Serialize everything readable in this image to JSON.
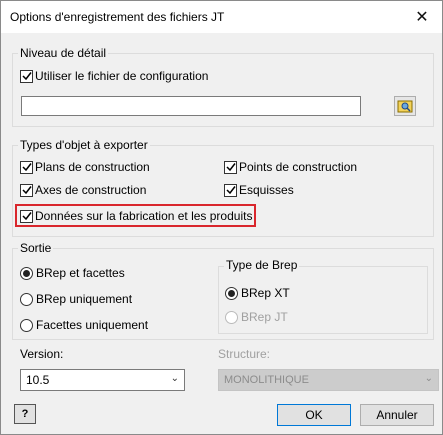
{
  "window": {
    "title": "Options d'enregistrement des fichiers JT",
    "close_glyph": "✕"
  },
  "detail": {
    "group_label": "Niveau de détail",
    "use_config_label": "Utiliser le fichier de configuration",
    "use_config_checked": true,
    "config_path_value": ""
  },
  "types": {
    "group_label": "Types d'objet à exporter",
    "items": [
      {
        "label": "Plans de construction",
        "checked": true
      },
      {
        "label": "Points de construction",
        "checked": true
      },
      {
        "label": "Axes de construction",
        "checked": true
      },
      {
        "label": "Esquisses",
        "checked": true
      },
      {
        "label": "Données sur la fabrication et les produits",
        "checked": true
      }
    ]
  },
  "output": {
    "group_label": "Sortie",
    "options": [
      {
        "label": "BRep et facettes",
        "selected": true
      },
      {
        "label": "BRep uniquement",
        "selected": false
      },
      {
        "label": "Facettes uniquement",
        "selected": false
      }
    ],
    "brep_type": {
      "group_label": "Type de Brep",
      "options": [
        {
          "label": "BRep XT",
          "selected": true,
          "enabled": true
        },
        {
          "label": "BRep JT",
          "selected": false,
          "enabled": false
        }
      ]
    }
  },
  "version": {
    "label": "Version:",
    "value": "10.5"
  },
  "structure": {
    "label": "Structure:",
    "value": "MONOLITHIQUE"
  },
  "buttons": {
    "help": "?",
    "ok": "OK",
    "cancel": "Annuler"
  },
  "colors": {
    "highlight": "#d9262c",
    "dialog_bg": "#f0f0f0"
  }
}
